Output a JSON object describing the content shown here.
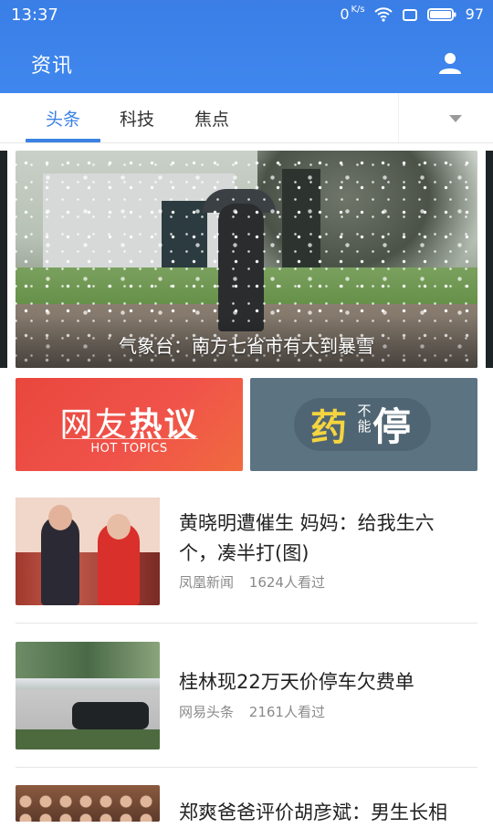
{
  "status_bar": {
    "time": "13:37",
    "net_speed_value": "0",
    "net_speed_unit": "K/s",
    "battery": "97"
  },
  "app_bar": {
    "title": "资讯"
  },
  "tabs": [
    {
      "label": "头条",
      "active": true
    },
    {
      "label": "科技"
    },
    {
      "label": "焦点"
    }
  ],
  "hero": {
    "caption": "气象台：南方七省市有大到暴雪"
  },
  "banners": {
    "hot": {
      "zh_prefix": "网友",
      "zh_bold": "热议",
      "en": "HOT TOPICS"
    },
    "drug": {
      "t1": "药",
      "t2_top": "不",
      "t2_bottom": "能",
      "t3": "停"
    }
  },
  "news": [
    {
      "title": "黄晓明遭催生 妈妈：给我生六个，凑半打(图)",
      "source": "凤凰新闻",
      "views": "1624人看过"
    },
    {
      "title": "桂林现22万天价停车欠费单",
      "source": "网易头条",
      "views": "2161人看过"
    },
    {
      "title": "郑爽爸爸评价胡彦斌：男生长相"
    }
  ],
  "colors": {
    "accent": "#3b82e4",
    "header": "#3f87ee",
    "hot_red": "#ef4d45",
    "drug_bg": "#5c7382",
    "drug_yellow": "#f4d43f"
  },
  "icons": {
    "user": "user-icon",
    "wifi": "wifi-icon",
    "battery": "battery-icon",
    "dropdown": "chevron-down-icon",
    "screen": "screen-icon"
  }
}
